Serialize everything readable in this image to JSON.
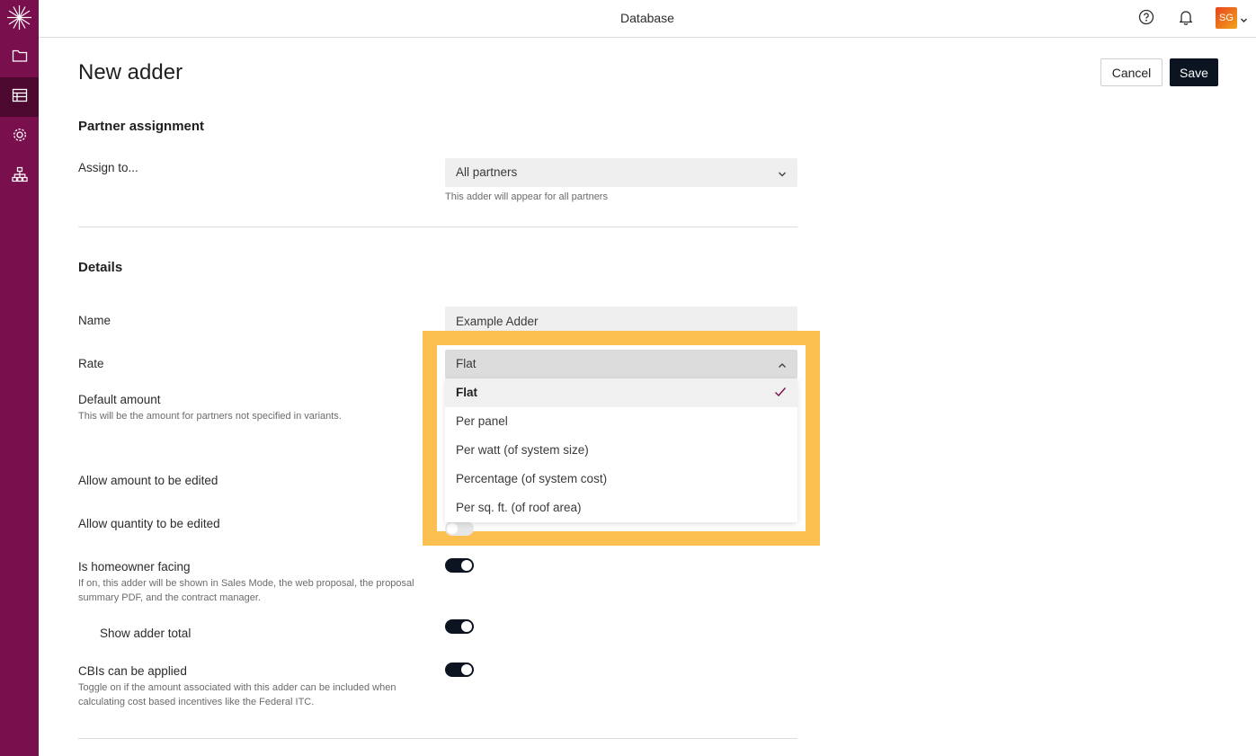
{
  "topbar": {
    "title": "Database",
    "avatar_initials": "SG"
  },
  "page": {
    "title": "New adder",
    "cancel_label": "Cancel",
    "save_label": "Save"
  },
  "partner_section": {
    "title": "Partner assignment",
    "assign_label": "Assign to...",
    "assign_value": "All partners",
    "assign_helper": "This adder will appear for all partners"
  },
  "details": {
    "title": "Details",
    "name_label": "Name",
    "name_value": "Example Adder",
    "rate_label": "Rate",
    "rate_value": "Flat",
    "rate_options": [
      {
        "label": "Flat",
        "selected": true
      },
      {
        "label": "Per panel",
        "selected": false
      },
      {
        "label": "Per watt (of system size)",
        "selected": false
      },
      {
        "label": "Percentage (of system cost)",
        "selected": false
      },
      {
        "label": "Per sq. ft. (of roof area)",
        "selected": false
      }
    ],
    "default_amount_label": "Default amount",
    "default_amount_helper": "This will be the amount for partners not specified in variants.",
    "allow_amount_label": "Allow amount to be edited",
    "allow_quantity_label": "Allow quantity to be edited",
    "allow_quantity_on": false,
    "homeowner_label": "Is homeowner facing",
    "homeowner_helper": "If on, this adder will be shown in Sales Mode, the web proposal, the proposal summary PDF, and the contract manager.",
    "homeowner_on": true,
    "show_total_label": "Show adder total",
    "show_total_on": true,
    "cbi_label": "CBIs can be applied",
    "cbi_helper": "Toggle on if the amount associated with this adder can be included when calculating cost based incentives like the Federal ITC.",
    "cbi_on": true
  },
  "colors": {
    "sidebar": "#7a0f4d",
    "sidebar_active": "#4d0830",
    "highlight": "#fbc04f",
    "primary_button": "#0b1420",
    "check": "#7a0f4d"
  },
  "icons": {
    "sidebar": [
      "logo-icon",
      "folder-icon",
      "database-table-icon",
      "settings-gear-icon",
      "org-chart-icon"
    ],
    "topbar": [
      "help-icon",
      "bell-icon",
      "chevron-down-icon"
    ]
  }
}
